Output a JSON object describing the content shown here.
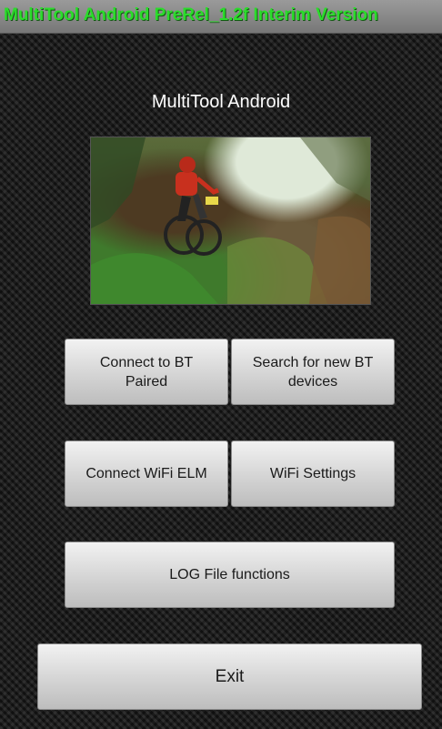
{
  "titlebar": {
    "text": "MultiTool Android PreRel_1.2f Interim Version"
  },
  "header": {
    "app_title": "MultiTool Android"
  },
  "photo": {
    "description_icon": "mountain-bike-photo"
  },
  "buttons": {
    "connect_bt": "Connect to BT\nPaired",
    "search_bt": "Search for new BT\ndevices",
    "connect_wifi": "Connect WiFi ELM",
    "wifi_settings": "WiFi Settings",
    "log_file": "LOG File functions",
    "exit": "Exit"
  },
  "colors": {
    "title_text": "#2bdc2b",
    "background": "#1b1b1b"
  }
}
